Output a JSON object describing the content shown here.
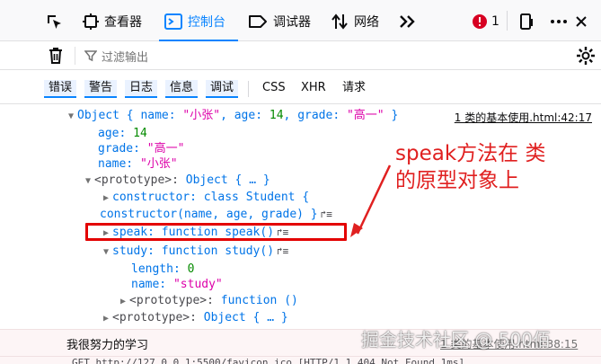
{
  "toolbar": {
    "tabs": [
      {
        "label": "查看器",
        "icon": "inspector-icon"
      },
      {
        "label": "控制台",
        "icon": "console-icon",
        "active": true
      },
      {
        "label": "调试器",
        "icon": "debugger-icon"
      },
      {
        "label": "网络",
        "icon": "network-icon"
      }
    ],
    "error_count": "1",
    "accent_color": "#0a84ff",
    "error_color": "#d70022"
  },
  "filter": {
    "placeholder": "过滤输出"
  },
  "categories": {
    "levels": [
      "错误",
      "警告",
      "日志",
      "信息",
      "调试"
    ],
    "types": [
      "CSS",
      "XHR",
      "请求"
    ]
  },
  "tree": {
    "root": {
      "prefix": "Object { ",
      "k1": "name: ",
      "v1": "\"小张\"",
      "sep1": ", ",
      "k2": "age: ",
      "v2": "14",
      "sep2": ", ",
      "k3": "grade: ",
      "v3": "\"高一\"",
      "suffix": " }"
    },
    "source": "1 类的基本使用.html:42:17",
    "age": {
      "key": "age: ",
      "value": "14"
    },
    "grade": {
      "key": "grade: ",
      "value": "\"高一\""
    },
    "name": {
      "key": "name: ",
      "value": "\"小张\""
    },
    "proto": {
      "key": "<prototype>: ",
      "value": "Object { … }"
    },
    "constructor_line1": {
      "key": "constructor: ",
      "value": "class Student {"
    },
    "constructor_line2": {
      "value": "constructor(name, age, grade) }"
    },
    "speak": {
      "key": "speak: ",
      "value": "function speak()"
    },
    "study": {
      "key": "study: ",
      "value": "function study()"
    },
    "study_length": {
      "key": "length: ",
      "value": "0"
    },
    "study_name": {
      "key": "name: ",
      "value": "\"study\""
    },
    "study_proto": {
      "key": "<prototype>: ",
      "value": "function ()"
    },
    "proto2": {
      "key": "<prototype>: ",
      "value": "Object { … }"
    }
  },
  "annotation": {
    "line1": "speak方法在 类",
    "line2": "的原型对象上",
    "color": "#e02020"
  },
  "log": {
    "text": "我很努力的学习",
    "source": "1 类的基本使用.html:38:15"
  },
  "request": {
    "text": "GET http://127.0.0.1:5500/favicon.ico   [HTTP/1.1 404 Not Found 1ms]"
  },
  "watermark": "掘金技术社区 @ 500佰"
}
